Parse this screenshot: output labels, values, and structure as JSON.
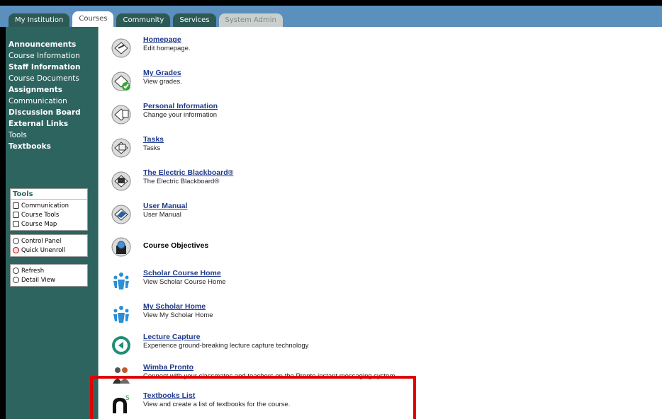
{
  "tabs": [
    {
      "label": "My Institution",
      "state": "normal"
    },
    {
      "label": "Courses",
      "state": "active"
    },
    {
      "label": "Community",
      "state": "normal"
    },
    {
      "label": "Services",
      "state": "normal"
    },
    {
      "label": "System Admin",
      "state": "disabled"
    }
  ],
  "nav": {
    "items": [
      "Announcements",
      "Course Information",
      "Staff Information",
      "Course Documents",
      "Assignments",
      "Communication",
      "Discussion Board",
      "External Links",
      "Tools",
      "Textbooks"
    ]
  },
  "toolbox": {
    "header": "Tools",
    "items": [
      "Communication",
      "Course Tools",
      "Course Map"
    ],
    "panel_items": [
      "Control Panel",
      "Quick Unenroll"
    ],
    "view_items": [
      "Refresh",
      "Detail View"
    ]
  },
  "list": [
    {
      "title": "Homepage",
      "desc": "Edit homepage.",
      "icon": "homepage-icon"
    },
    {
      "title": "My Grades",
      "desc": "View grades.",
      "icon": "grades-icon"
    },
    {
      "title": "Personal Information",
      "desc": "Change your information",
      "icon": "personal-info-icon"
    },
    {
      "title": "Tasks",
      "desc": "Tasks",
      "icon": "tasks-icon"
    },
    {
      "title": "The Electric Blackboard®",
      "desc": "The Electric Blackboard®",
      "icon": "electric-blackboard-icon"
    },
    {
      "title": "User Manual",
      "desc": "User Manual",
      "icon": "user-manual-icon"
    },
    {
      "title": "Course Objectives",
      "desc": "",
      "icon": "course-objectives-icon"
    },
    {
      "title": "Scholar Course Home",
      "desc": "View Scholar Course Home",
      "icon": "scholar-icon"
    },
    {
      "title": "My Scholar Home",
      "desc": "View My Scholar Home",
      "icon": "scholar-icon"
    },
    {
      "title": "Lecture Capture",
      "desc": "Experience ground-breaking lecture capture technology",
      "icon": "lecture-capture-icon"
    },
    {
      "title": "Wimba Pronto",
      "desc": "Connect with your classmates and teachers on the Pronto instant messaging system.",
      "icon": "wimba-pronto-icon"
    },
    {
      "title": "Textbooks List",
      "desc": "View and create a list of textbooks for the course.",
      "icon": "textbooks-list-icon"
    }
  ],
  "colors": {
    "topbar": "#5b8fbd",
    "frame": "#2e6460",
    "link": "#1f3a8a",
    "highlight": "#e00000"
  }
}
